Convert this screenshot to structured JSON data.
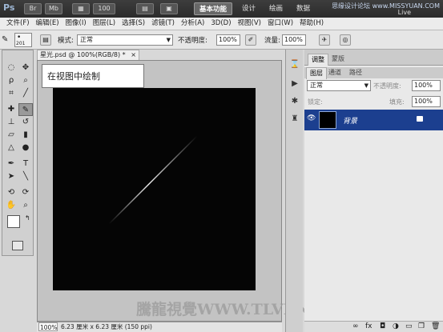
{
  "app": {
    "logo": "Ps",
    "workspace_buttons": [
      "基本功能",
      "设计",
      "绘画",
      "数据"
    ],
    "active_workspace": "基本功能",
    "site_watermark": "思缘设计论坛 www.MISSYUAN.COM",
    "live_label": "Live"
  },
  "menu": [
    "文件(F)",
    "编辑(E)",
    "图像(I)",
    "图层(L)",
    "选择(S)",
    "滤镜(T)",
    "分析(A)",
    "3D(D)",
    "视图(V)",
    "窗口(W)",
    "帮助(H)"
  ],
  "options": {
    "brush_size": "201",
    "mode_label": "模式:",
    "mode_value": "正常",
    "opacity_label": "不透明度:",
    "opacity_value": "100%",
    "flow_label": "流量:",
    "flow_value": "100%"
  },
  "document": {
    "tab_title": "星光.psd @ 100%(RGB/8) *",
    "callout": "在视图中绘制",
    "zoom": "100%",
    "doc_size": "6.23 厘米 x 6.23 厘米 (150 ppi)",
    "watermark": "騰龍視覺WWW.TLVI.NET"
  },
  "panels": {
    "top_tabs": [
      "调整",
      "蒙版"
    ],
    "layer_tabs": [
      "图层",
      "通道",
      "路径"
    ],
    "blend_mode": "正常",
    "opacity_label": "不透明度:",
    "opacity_value": "100%",
    "lock_label": "锁定:",
    "fill_label": "填充:",
    "fill_value": "100%",
    "layer_name": "背景"
  },
  "colors": {
    "accent": "#1c3f8f",
    "canvas": "#050505"
  }
}
